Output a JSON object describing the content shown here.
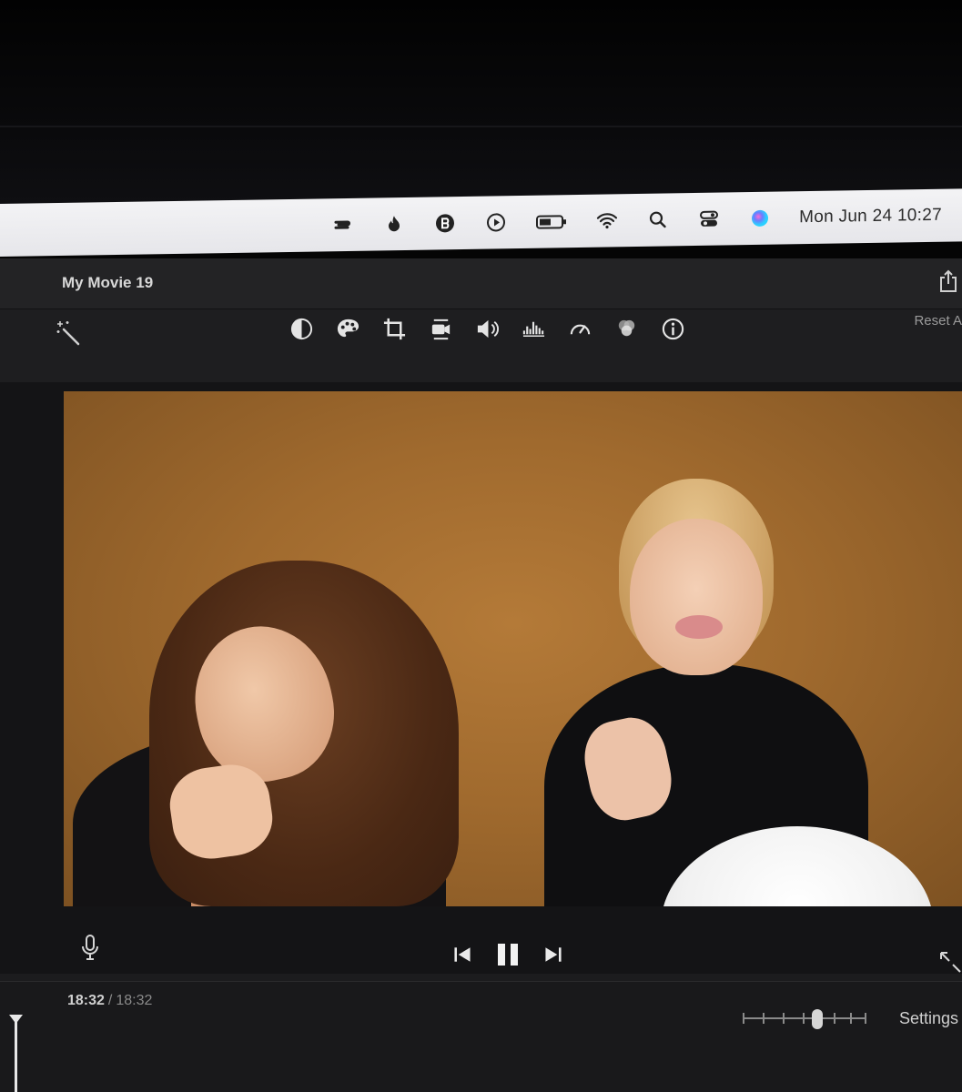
{
  "menubar": {
    "icons": [
      "expressvpn-icon",
      "flame-icon",
      "bluetooth-badge-icon",
      "play-circle-icon",
      "battery-icon",
      "wifi-icon",
      "search-icon",
      "control-center-icon",
      "siri-icon"
    ],
    "clock": "Mon Jun 24  10:27"
  },
  "window": {
    "title": "My Movie 19"
  },
  "toolbar": {
    "tools": [
      "color-balance-icon",
      "color-palette-icon",
      "crop-icon",
      "stabilization-icon",
      "volume-icon",
      "equalizer-icon",
      "speed-icon",
      "filters-icon",
      "info-icon"
    ],
    "reset_label": "Reset A"
  },
  "playback": {
    "current_time": "18:32",
    "separator": "/",
    "total_time": "18:32",
    "state": "playing"
  },
  "timeline": {
    "settings_label": "Settings",
    "zoom_level": 0.6
  },
  "colors": {
    "backdrop": "#a06a2e",
    "app_bg": "#1c1c1e"
  }
}
